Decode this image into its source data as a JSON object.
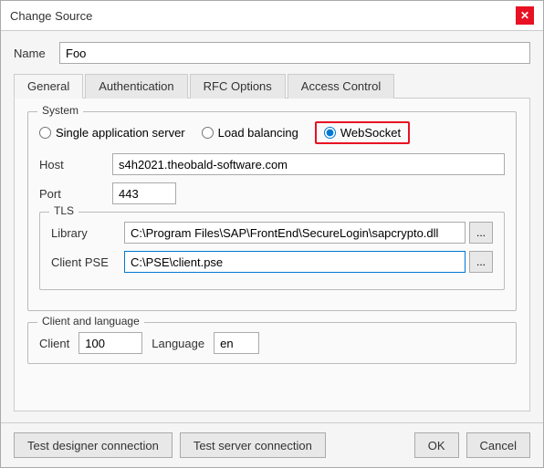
{
  "dialog": {
    "title": "Change Source",
    "close_label": "✕"
  },
  "name_field": {
    "label": "Name",
    "value": "Foo",
    "placeholder": ""
  },
  "tabs": [
    {
      "id": "general",
      "label": "General",
      "active": true
    },
    {
      "id": "authentication",
      "label": "Authentication",
      "active": false
    },
    {
      "id": "rfc-options",
      "label": "RFC Options",
      "active": false
    },
    {
      "id": "access-control",
      "label": "Access Control",
      "active": false
    }
  ],
  "system_section": {
    "legend": "System",
    "radio_options": [
      {
        "id": "single",
        "label": "Single application server",
        "checked": false
      },
      {
        "id": "load-balancing",
        "label": "Load balancing",
        "checked": false
      },
      {
        "id": "websocket",
        "label": "WebSocket",
        "checked": true
      }
    ]
  },
  "host_field": {
    "label": "Host",
    "value": "s4h2021.theobald-software.com"
  },
  "port_field": {
    "label": "Port",
    "value": "443"
  },
  "tls_section": {
    "legend": "TLS",
    "library_label": "Library",
    "library_value": "C:\\Program Files\\SAP\\FrontEnd\\SecureLogin\\sapcrypto.dll",
    "library_browse": "...",
    "client_pse_label": "Client PSE",
    "client_pse_value": "C:\\PSE\\client.pse",
    "client_pse_browse": "..."
  },
  "client_language_section": {
    "legend": "Client and language",
    "client_label": "Client",
    "client_value": "100",
    "language_label": "Language",
    "language_value": "en"
  },
  "footer": {
    "test_designer_label": "Test designer connection",
    "test_server_label": "Test server connection",
    "ok_label": "OK",
    "cancel_label": "Cancel"
  }
}
